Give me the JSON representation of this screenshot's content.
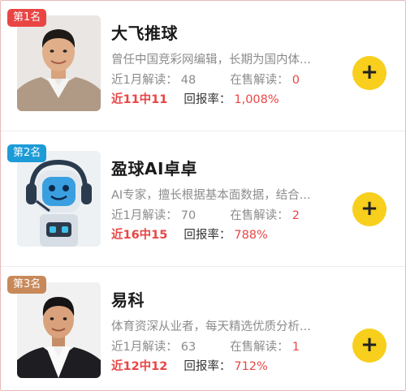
{
  "experts": [
    {
      "rank_label": "第1名",
      "rank_color": "#e94545",
      "name": "大飞推球",
      "desc": "曾任中国竞彩网编辑，长期为国内体...",
      "month_label": "近1月解读：",
      "month_value": "48",
      "sale_label": "在售解读：",
      "sale_value": "0",
      "record": "近11中11",
      "roi_label": "回报率：",
      "roi_value": "1,008%",
      "add_icon": "plus-icon"
    },
    {
      "rank_label": "第2名",
      "rank_color": "#1d9bd7",
      "name": "盈球AI卓卓",
      "desc": "AI专家，擅长根据基本面数据，结合...",
      "month_label": "近1月解读：",
      "month_value": "70",
      "sale_label": "在售解读：",
      "sale_value": "2",
      "record": "近16中15",
      "roi_label": "回报率：",
      "roi_value": "788%",
      "add_icon": "plus-icon"
    },
    {
      "rank_label": "第3名",
      "rank_color": "#c8895a",
      "name": "易科",
      "desc": "体育资深从业者，每天精选优质分析...",
      "month_label": "近1月解读：",
      "month_value": "63",
      "sale_label": "在售解读：",
      "sale_value": "1",
      "record": "近12中12",
      "roi_label": "回报率：",
      "roi_value": "712%",
      "add_icon": "plus-icon"
    }
  ],
  "colors": {
    "accent_red": "#e94545",
    "follow_yellow": "#f7cf1c"
  }
}
